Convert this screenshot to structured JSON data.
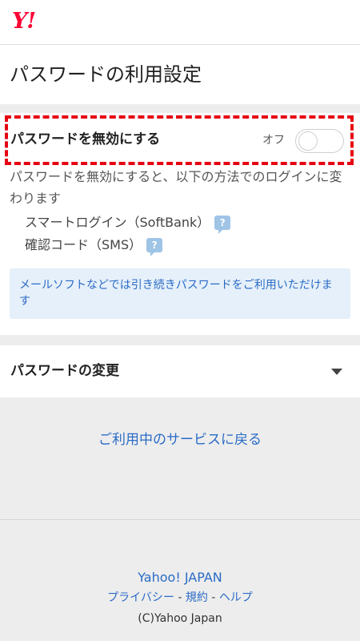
{
  "header": {
    "logo_text": "Y!"
  },
  "page": {
    "title": "パスワードの利用設定"
  },
  "disable_section": {
    "label": "パスワードを無効にする",
    "toggle_state": "オフ",
    "toggle_on": false,
    "description": "パスワードを無効にすると、以下の方法でのログインに変わります",
    "methods": [
      {
        "label": "スマートログイン（SoftBank）",
        "help": "?"
      },
      {
        "label": "確認コード（SMS）",
        "help": "?"
      }
    ],
    "notice": "メールソフトなどでは引き続きパスワードをご利用いただけます"
  },
  "change_section": {
    "label": "パスワードの変更"
  },
  "back_link": "ご利用中のサービスに戻る",
  "footer": {
    "brand": "Yahoo! JAPAN",
    "links": [
      "プライバシー",
      "規約",
      "ヘルプ"
    ],
    "separator": " - ",
    "copyright": "(C)Yahoo Japan"
  },
  "colors": {
    "accent_red": "#e60012",
    "logo_red": "#ff0033",
    "link_blue": "#2a6bc6",
    "notice_bg": "#e6f0fa",
    "help_icon": "#9fc4e6"
  },
  "icons": {
    "help": "help-question-icon",
    "expand": "chevron-down-icon"
  }
}
